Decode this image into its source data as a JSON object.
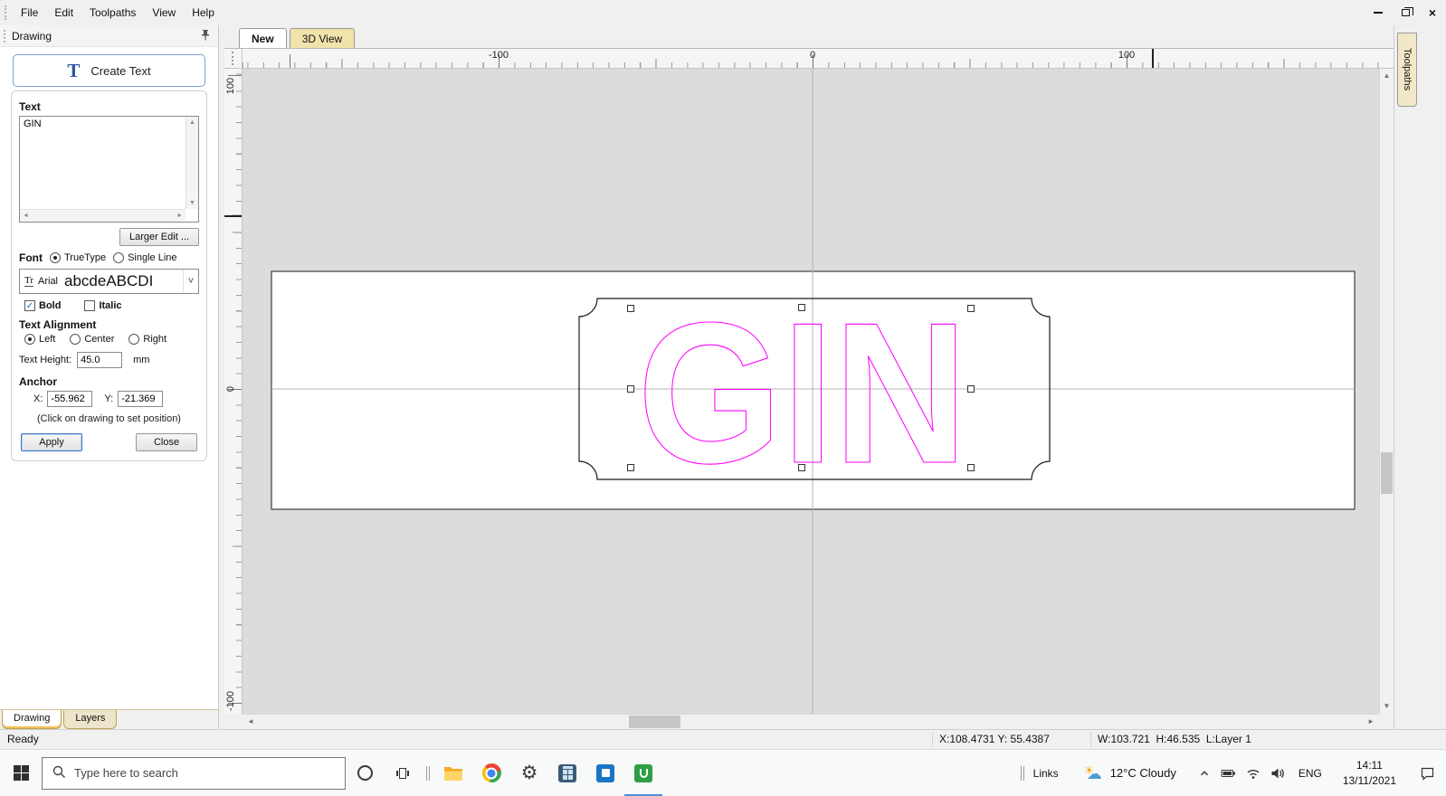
{
  "window": {
    "menu": [
      "File",
      "Edit",
      "Toolpaths",
      "View",
      "Help"
    ]
  },
  "icons": {
    "close": "×",
    "check": "✓",
    "dropdown_arrow": "˅",
    "scroll_up": "▲",
    "scroll_down": "▼",
    "scroll_left": "◄",
    "scroll_right": "►",
    "sun": "☀",
    "cloud": "☁",
    "gear": "⚙",
    "tt_glyph": "Tr"
  },
  "panel": {
    "title": "Drawing",
    "create_text_title": "Create Text",
    "text_label": "Text",
    "text_value": "GIN",
    "larger_edit_label": "Larger Edit ...",
    "font_label": "Font",
    "font_truetype": "TrueType",
    "font_single_line": "Single Line",
    "font_name": "Arial",
    "font_preview": "abcdeABCDI",
    "bold_label": "Bold",
    "italic_label": "Italic",
    "alignment_label": "Text Alignment",
    "align_left": "Left",
    "align_center": "Center",
    "align_right": "Right",
    "text_height_label": "Text Height:",
    "text_height_value": "45.0",
    "text_height_unit": "mm",
    "anchor_label": "Anchor",
    "anchor_x_label": "X:",
    "anchor_x_value": "-55.962",
    "anchor_y_label": "Y:",
    "anchor_y_value": "-21.369",
    "anchor_hint": "(Click on drawing to set position)",
    "apply_label": "Apply",
    "close_label": "Close",
    "tab_drawing": "Drawing",
    "tab_layers": "Layers"
  },
  "canvas": {
    "tab_new": "New",
    "tab_3d": "3D View",
    "toolpaths_tab": "Toolpaths",
    "ruler_h": [
      "-100",
      "0",
      "100"
    ],
    "ruler_v": [
      "100",
      "0",
      "-100"
    ],
    "drawing_text": "GIN",
    "outline_color": "#ff00ff"
  },
  "status": {
    "ready": "Ready",
    "coords": "X:108.4731 Y: 55.4387",
    "dims": "W:103.721  H:46.535  L:Layer 1"
  },
  "taskbar": {
    "search_placeholder": "Type here to search",
    "links_label": "Links",
    "weather": "12°C Cloudy",
    "language": "ENG",
    "time": "14:11",
    "date": "13/11/2021"
  }
}
